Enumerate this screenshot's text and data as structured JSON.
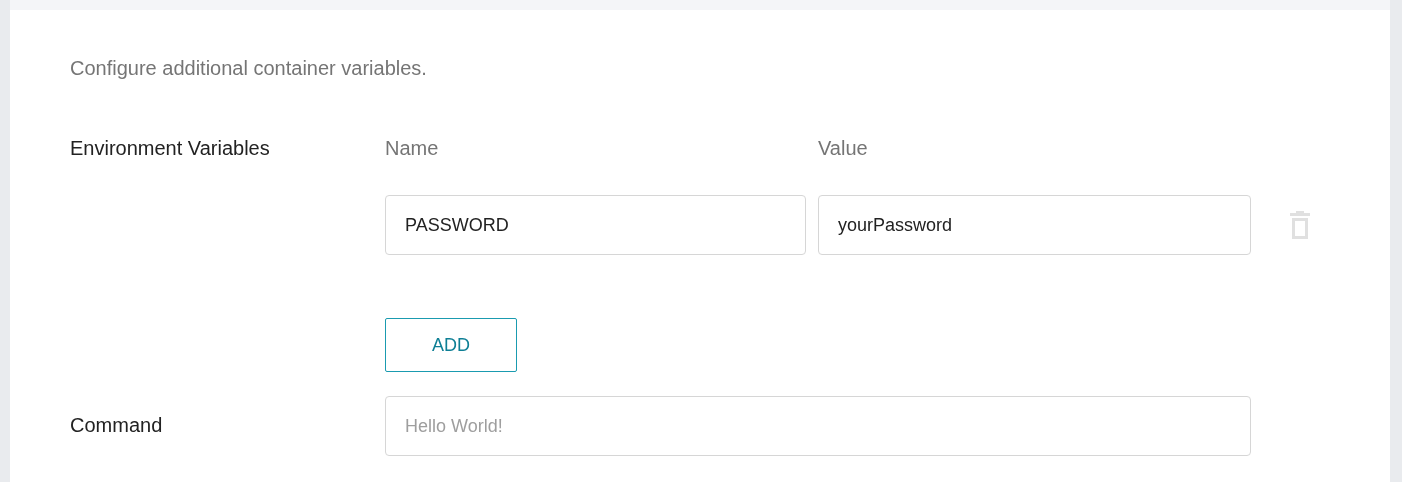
{
  "description": "Configure additional container variables.",
  "environment": {
    "label": "Environment Variables",
    "columns": [
      "Name",
      "Value"
    ],
    "rows": [
      {
        "name": "PASSWORD",
        "value": "yourPassword"
      }
    ],
    "add_button": "ADD"
  },
  "command": {
    "label": "Command",
    "placeholder": "Hello World!"
  }
}
